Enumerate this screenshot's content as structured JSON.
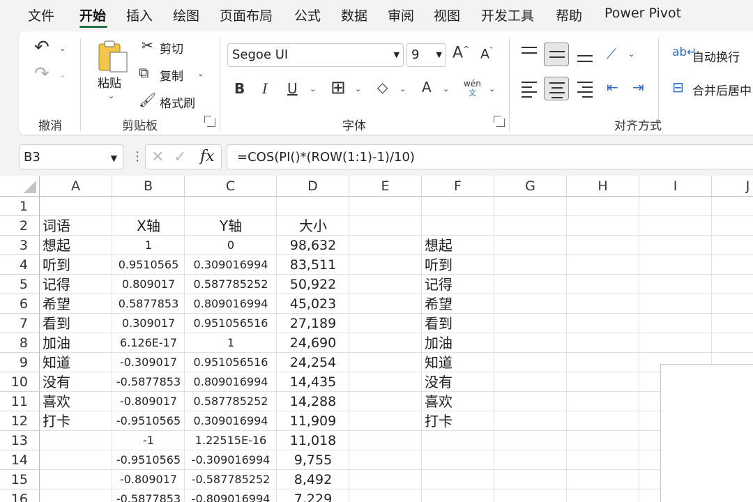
{
  "menu": [
    "文件",
    "开始",
    "插入",
    "绘图",
    "页面布局",
    "公式",
    "数据",
    "审阅",
    "视图",
    "开发工具",
    "帮助",
    "Power Pivot"
  ],
  "ribbon": {
    "undo_group": "撤消",
    "clipboard": {
      "paste": "粘贴",
      "cut": "剪切",
      "copy": "复制",
      "format_painter": "格式刷",
      "label": "剪贴板"
    },
    "font": {
      "name": "Segoe UI",
      "size": "9",
      "label": "字体",
      "phonetic": "wén",
      "phonetic_char": "文",
      "bold": "B",
      "italic": "I",
      "underline": "U",
      "font_color": "A"
    },
    "alignment": {
      "wrap_text": "自动换行",
      "merge_center": "合并后居中",
      "label": "对齐方式"
    }
  },
  "formula_bar": {
    "name_box": "B3",
    "formula": "=COS(PI()*(ROW(1:1)-1)/10)",
    "fx": "fx"
  },
  "sheet": {
    "columns": [
      "A",
      "B",
      "C",
      "D",
      "E",
      "F",
      "G",
      "H",
      "I",
      "J"
    ],
    "rows": [
      "1",
      "2",
      "3",
      "4",
      "5",
      "6",
      "7",
      "8",
      "9",
      "10",
      "11",
      "12",
      "13",
      "14",
      "15",
      "16"
    ],
    "headers": {
      "a": "词语",
      "b": "X轴",
      "c": "Y轴",
      "d": "大小"
    },
    "data": [
      {
        "a": "想起",
        "b": "1",
        "c": "0",
        "d": "98,632",
        "f": "想起"
      },
      {
        "a": "听到",
        "b": "0.9510565",
        "c": "0.309016994",
        "d": "83,511",
        "f": "听到"
      },
      {
        "a": "记得",
        "b": "0.809017",
        "c": "0.587785252",
        "d": "50,922",
        "f": "记得"
      },
      {
        "a": "希望",
        "b": "0.5877853",
        "c": "0.809016994",
        "d": "45,023",
        "f": "希望"
      },
      {
        "a": "看到",
        "b": "0.309017",
        "c": "0.951056516",
        "d": "27,189",
        "f": "看到"
      },
      {
        "a": "加油",
        "b": "6.126E-17",
        "c": "1",
        "d": "24,690",
        "f": "加油"
      },
      {
        "a": "知道",
        "b": "-0.309017",
        "c": "0.951056516",
        "d": "24,254",
        "f": "知道"
      },
      {
        "a": "没有",
        "b": "-0.5877853",
        "c": "0.809016994",
        "d": "14,435",
        "f": "没有"
      },
      {
        "a": "喜欢",
        "b": "-0.809017",
        "c": "0.587785252",
        "d": "14,288",
        "f": "喜欢"
      },
      {
        "a": "打卡",
        "b": "-0.9510565",
        "c": "0.309016994",
        "d": "11,909",
        "f": "打卡"
      },
      {
        "a": "",
        "b": "-1",
        "c": "1.22515E-16",
        "d": "11,018",
        "f": ""
      },
      {
        "a": "",
        "b": "-0.9510565",
        "c": "-0.309016994",
        "d": "9,755",
        "f": ""
      },
      {
        "a": "",
        "b": "-0.809017",
        "c": "-0.587785252",
        "d": "8,492",
        "f": ""
      },
      {
        "a": "",
        "b": "-0.5877853",
        "c": "-0.809016994",
        "d": "7,229",
        "f": ""
      }
    ]
  }
}
